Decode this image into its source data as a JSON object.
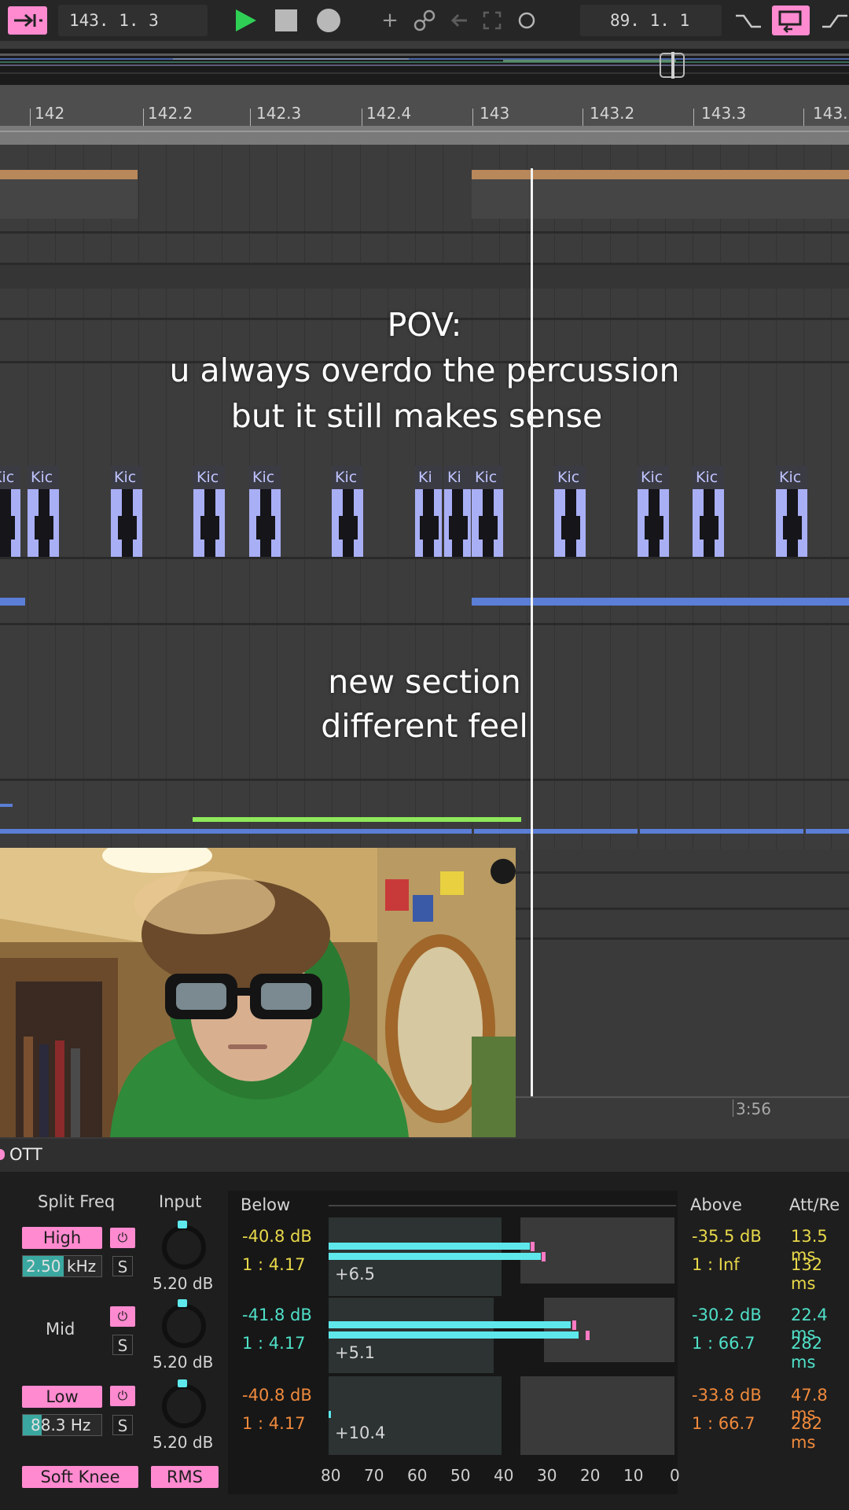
{
  "transport": {
    "position": "143.  1.  3",
    "loop_start": "89.  1.  1"
  },
  "ruler": {
    "bars": [
      "142",
      "142.2",
      "142.3",
      "142.4",
      "143",
      "143.2",
      "143.3",
      "143."
    ]
  },
  "overlays": {
    "caption_line1": "POV:",
    "caption_line2": "u always overdo the percussion",
    "caption_line3": "but it still makes sense",
    "section_line1": "new section",
    "section_line2": "different feel"
  },
  "clips": {
    "label_full": "Kic",
    "label_short": "Ki"
  },
  "timeline": {
    "time_marker": "3:56"
  },
  "device": {
    "name": "OTT",
    "split_freq_label": "Split Freq",
    "input_label": "Input",
    "below_label": "Below",
    "above_label": "Above",
    "att_rel_label": "Att/Re",
    "high_label": "High",
    "mid_label": "Mid",
    "low_label": "Low",
    "high_freq_value": "2.50",
    "high_freq_unit": "kHz",
    "low_freq_value": "88.3 Hz",
    "solo_label": "S",
    "power_label": "⏻",
    "soft_knee_label": "Soft Knee",
    "rms_label": "RMS",
    "bands": [
      {
        "input": "5.20 dB",
        "below_db": "-40.8 dB",
        "below_ratio": "1 : 4.17",
        "gain": "+6.5",
        "above_db": "-35.5 dB",
        "above_ratio": "1 : Inf",
        "attack": "13.5 ms",
        "release": "132 ms"
      },
      {
        "input": "5.20 dB",
        "below_db": "-41.8 dB",
        "below_ratio": "1 : 4.17",
        "gain": "+5.1",
        "above_db": "-30.2 dB",
        "above_ratio": "1 : 66.7",
        "attack": "22.4 ms",
        "release": "282 ms"
      },
      {
        "input": "5.20 dB",
        "below_db": "-40.8 dB",
        "below_ratio": "1 : 4.17",
        "gain": "+10.4",
        "above_db": "-33.8 dB",
        "above_ratio": "1 : 66.7",
        "attack": "47.8 ms",
        "release": "282 ms"
      }
    ],
    "scale": [
      "80",
      "70",
      "60",
      "50",
      "40",
      "30",
      "20",
      "10",
      "0"
    ]
  },
  "colors": {
    "accent_pink": "#ff8ad0",
    "play_green": "#2fcf55",
    "clip_blue": "#a9aff5",
    "meter_cyan": "#5ee8ec"
  }
}
